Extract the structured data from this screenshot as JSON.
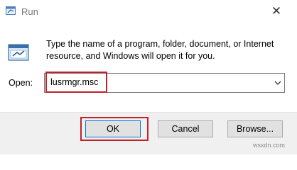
{
  "window": {
    "title": "Run",
    "title_icon": "run-icon",
    "close_icon": "close-icon",
    "close_glyph": "✕"
  },
  "body": {
    "app_icon": "run-app-icon",
    "description": "Type the name of a program, folder, document, or Internet resource, and Windows will open it for you."
  },
  "open_field": {
    "label": "Open:",
    "value": "lusrmgr.msc",
    "dropdown_icon": "chevron-down-icon"
  },
  "buttons": {
    "ok": "OK",
    "cancel": "Cancel",
    "browse": "Browse..."
  },
  "watermark": "wsxdn.com",
  "colors": {
    "highlight": "#c0212b",
    "footer": "#f0f0f0",
    "accent": "#0078d7"
  }
}
